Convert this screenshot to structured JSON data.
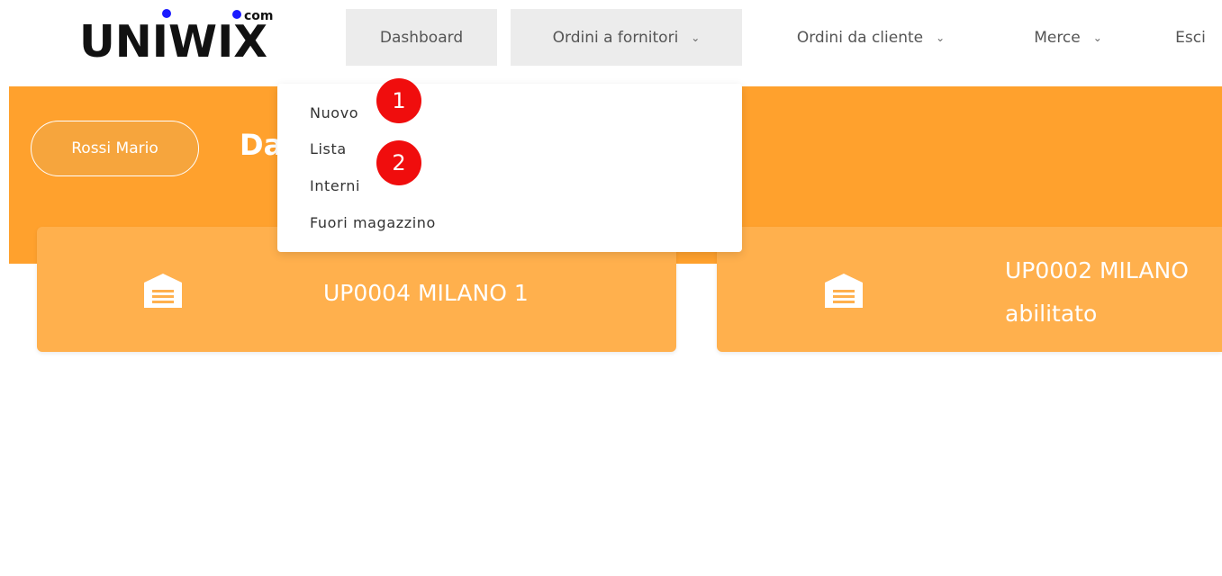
{
  "logo": {
    "name": "UNIWIX",
    "suffix": "com"
  },
  "nav": {
    "dashboard": "Dashboard",
    "ordini_fornitori": "Ordini a fornitori",
    "ordini_cliente": "Ordini da cliente",
    "merce": "Merce",
    "esci": "Esci",
    "chevron": "⌄"
  },
  "hero": {
    "user": "Rossi Mario",
    "title": "Dashboard"
  },
  "dropdown": {
    "items": [
      "Nuovo",
      "Lista",
      "Interni",
      "Fuori magazzino"
    ]
  },
  "annotations": [
    "1",
    "2"
  ],
  "cards": [
    {
      "line1": "UP0004 MILANO 1",
      "line2": ""
    },
    {
      "line1": "UP0002 MILANO",
      "line2": "abilitato"
    }
  ],
  "colors": {
    "accent": "#ffa12d",
    "card": "#ffb04d",
    "badge": "#f00d0d",
    "logo_dot": "#1a1aff"
  },
  "icons": {
    "card": "warehouse-icon",
    "dropdown": "chevron-down-icon"
  }
}
